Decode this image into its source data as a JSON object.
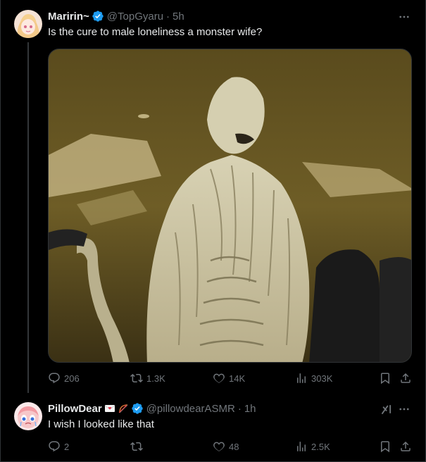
{
  "post": {
    "author_name": "Maririn~",
    "handle": "@TopGyaru",
    "separator": "·",
    "time": "5h",
    "text": "Is the cure to male loneliness a monster wife?",
    "stats": {
      "replies": "206",
      "reposts": "1.3K",
      "likes": "14K",
      "views": "303K"
    }
  },
  "reply": {
    "author_name": "PillowDear",
    "handle": "@pillowdearASMR",
    "separator": "·",
    "time": "1h",
    "text": "I wish I looked like that",
    "stats": {
      "replies": "2",
      "reposts": "",
      "likes": "48",
      "views": "2.5K"
    }
  },
  "icons": {
    "verified": "verified-badge-icon",
    "more": "more-dots-icon",
    "reply": "reply-bubble-icon",
    "repost": "repost-arrows-icon",
    "like": "heart-icon",
    "views": "views-bars-icon",
    "bookmark": "bookmark-icon",
    "share": "share-icon",
    "grok": "grok-icon",
    "name_emojis": [
      "love-letter-emoji",
      "bow-and-arrow-emoji"
    ]
  },
  "colors": {
    "background": "#000000",
    "text_primary": "#e7e9ea",
    "text_secondary": "#71767b",
    "verified_blue": "#1d9bf0",
    "divider": "#2f3336"
  }
}
